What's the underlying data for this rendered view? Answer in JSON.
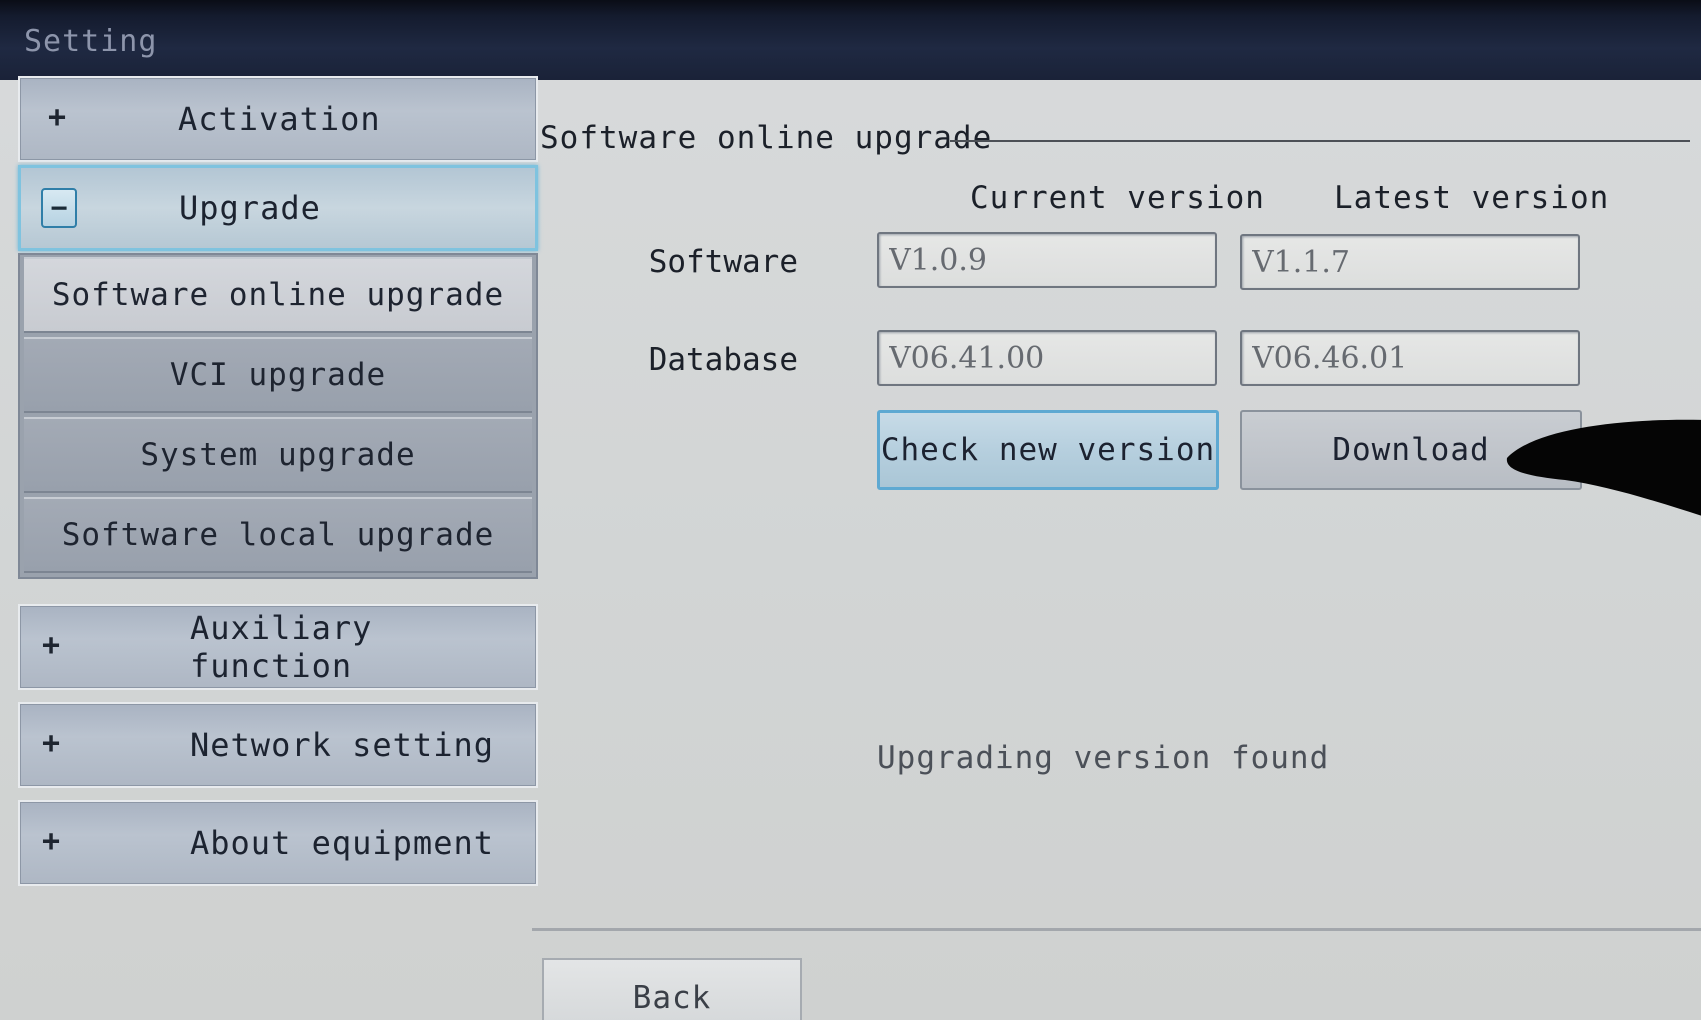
{
  "window": {
    "title": "Setting"
  },
  "sidebar": {
    "items": [
      {
        "id": "activation",
        "sign": "+",
        "label": "Activation"
      },
      {
        "id": "upgrade",
        "sign": "−",
        "label": "Upgrade"
      },
      {
        "id": "auxiliary",
        "sign": "+",
        "label": "Auxiliary function"
      },
      {
        "id": "network",
        "sign": "+",
        "label": "Network setting"
      },
      {
        "id": "about",
        "sign": "+",
        "label": "About equipment"
      }
    ],
    "upgrade_subitems": [
      {
        "label": "Software online upgrade",
        "selected": true
      },
      {
        "label": "VCI upgrade",
        "selected": false
      },
      {
        "label": "System upgrade",
        "selected": false
      },
      {
        "label": "Software local upgrade",
        "selected": false
      }
    ]
  },
  "main": {
    "section_title": "Software online upgrade",
    "columns": {
      "current": "Current version",
      "latest": "Latest version"
    },
    "rows": [
      {
        "label": "Software",
        "current": "V1.0.9",
        "latest": "V1.1.7"
      },
      {
        "label": "Database",
        "current": "V06.41.00",
        "latest": "V06.46.01"
      }
    ],
    "buttons": {
      "check": "Check new version",
      "download": "Download"
    },
    "status": "Upgrading version found",
    "back": "Back"
  },
  "colors": {
    "title_bar": "#1f2942",
    "active_border": "#5ea9d2",
    "panel_bg": "#d6d8d9"
  }
}
